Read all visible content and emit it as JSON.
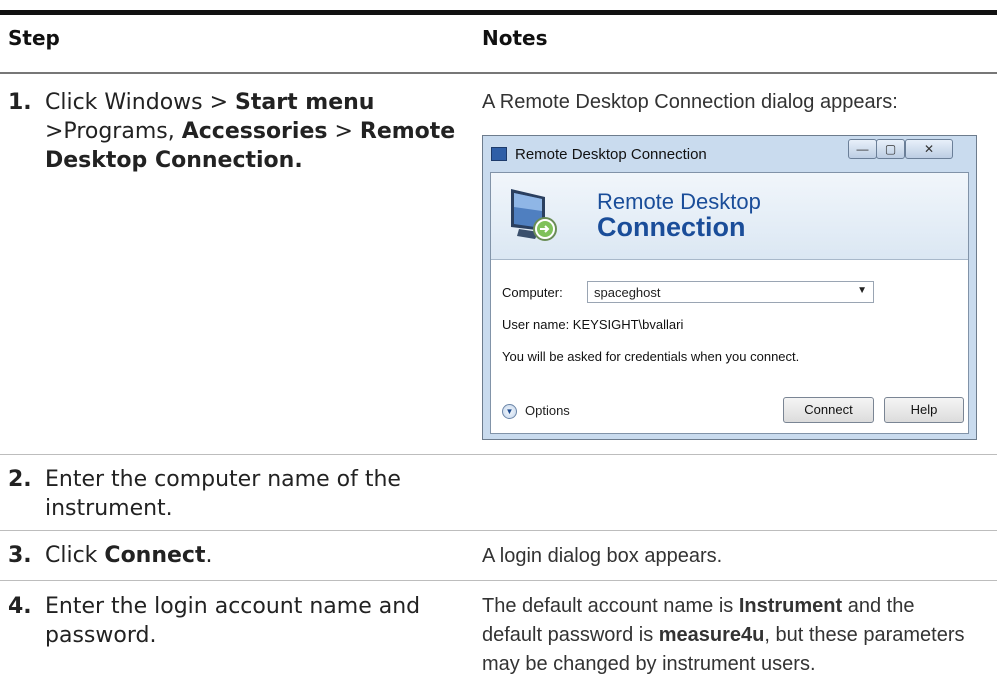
{
  "header": {
    "step": "Step",
    "notes": "Notes"
  },
  "steps": [
    {
      "num": "1.",
      "pre": "Click Windows > ",
      "b1": "Start menu",
      "mid": " >Programs, ",
      "b2": "Accessories",
      "post": " > ",
      "b3": "Remote Desktop Connection."
    },
    {
      "num": "2.",
      "text": "Enter the computer name of the instrument."
    },
    {
      "num": "3.",
      "pre": "Click ",
      "bold": "Connect",
      "post": "."
    },
    {
      "num": "4.",
      "text": "Enter the login account name and password."
    }
  ],
  "notes": {
    "n1": "A Remote Desktop Connection dialog appears:",
    "n3": "A login dialog box appears.",
    "n4_a": "The default account name is ",
    "n4_b": "Instrument",
    "n4_c": " and the default password is ",
    "n4_d": "measure4u",
    "n4_e": ", but these parameters may be changed by instrument users."
  },
  "dialog": {
    "title": "Remote Desktop Connection",
    "banner_line1": "Remote Desktop",
    "banner_line2": "Connection",
    "computer_label": "Computer:",
    "computer_value": "spaceghost",
    "user_text": "User name:  KEYSIGHT\\bvallari",
    "info_text": "You will be asked for credentials when you connect.",
    "options_label": "Options",
    "connect_label": "Connect",
    "help_label": "Help",
    "window_buttons": {
      "minimize": "—",
      "maximize": "▢",
      "close": "✕"
    }
  }
}
